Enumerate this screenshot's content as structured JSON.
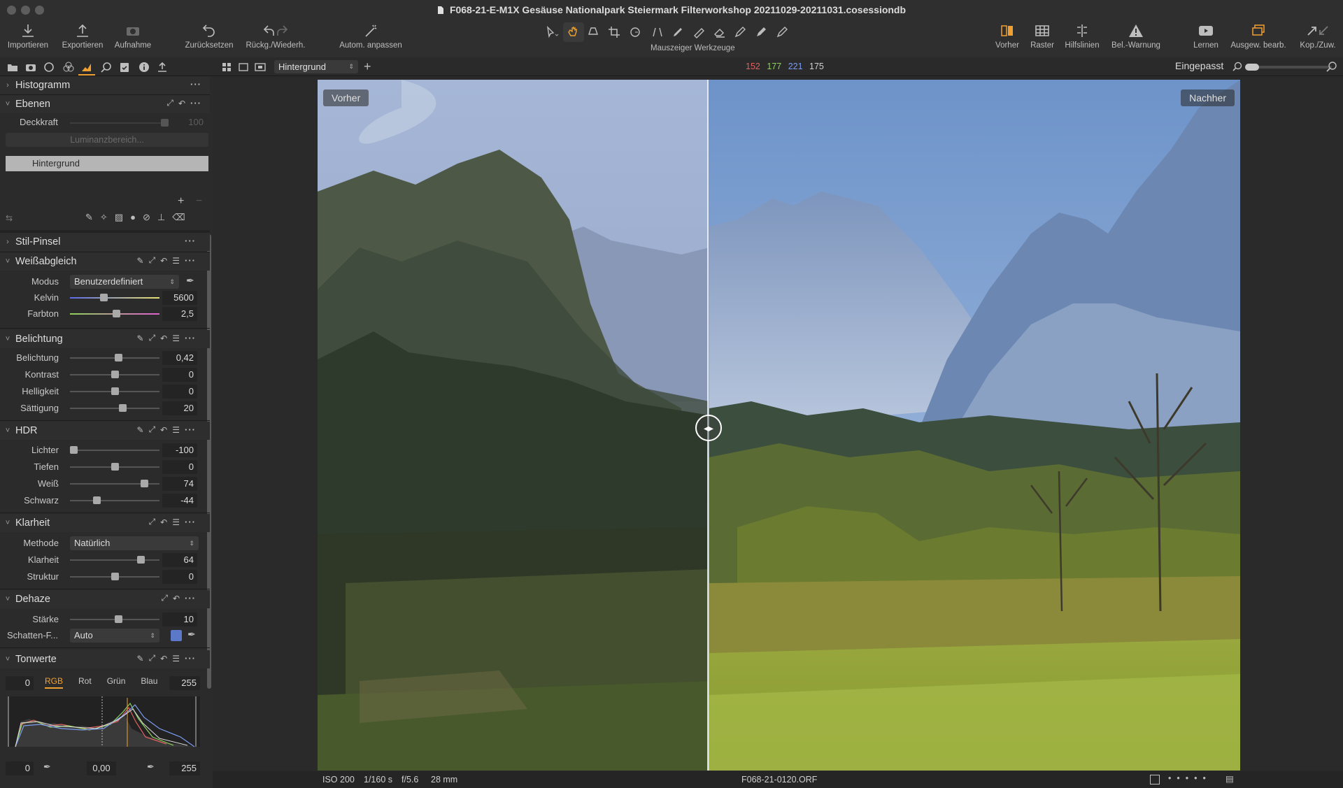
{
  "window": {
    "title": "F068-21-E-M1X Gesäuse Nationalpark Steiermark Filterworkshop 20211029-20211031.cosessiondb"
  },
  "toolbar": {
    "left": [
      "Importieren",
      "Exportieren",
      "Aufnahme",
      "Zurücksetzen",
      "Rückg./Wiederh.",
      "Autom. anpassen"
    ],
    "center_label": "Mauszeiger Werkzeuge",
    "right": [
      "Vorher",
      "Raster",
      "Hilfslinien",
      "Bel.-Warnung",
      "Lernen",
      "Ausgew. bearb.",
      "Kop./Zuw."
    ]
  },
  "viewer_bar": {
    "layer_select": "Hintergrund",
    "rgb": {
      "r": "152",
      "g": "177",
      "b": "221",
      "l": "175"
    },
    "zoom_label": "Eingepasst"
  },
  "panels": {
    "histogramm": {
      "title": "Histogramm"
    },
    "ebenen": {
      "title": "Ebenen",
      "opacity_label": "Deckkraft",
      "opacity_value": "100",
      "luminance_button": "Luminanzbereich...",
      "layer": "Hintergrund"
    },
    "stil": {
      "title": "Stil-Pinsel"
    },
    "wb": {
      "title": "Weißabgleich",
      "mode_label": "Modus",
      "mode_value": "Benutzerdefiniert",
      "kelvin_label": "Kelvin",
      "kelvin_value": "5600",
      "kelvin_pos": 0.38,
      "tint_label": "Farbton",
      "tint_value": "2,5",
      "tint_pos": 0.52
    },
    "exposure": {
      "title": "Belichtung",
      "rows": [
        {
          "label": "Belichtung",
          "value": "0,42",
          "pos": 0.54
        },
        {
          "label": "Kontrast",
          "value": "0",
          "pos": 0.5
        },
        {
          "label": "Helligkeit",
          "value": "0",
          "pos": 0.5
        },
        {
          "label": "Sättigung",
          "value": "20",
          "pos": 0.59
        }
      ]
    },
    "hdr": {
      "title": "HDR",
      "rows": [
        {
          "label": "Lichter",
          "value": "-100",
          "pos": 0.04
        },
        {
          "label": "Tiefen",
          "value": "0",
          "pos": 0.5
        },
        {
          "label": "Weiß",
          "value": "74",
          "pos": 0.83
        },
        {
          "label": "Schwarz",
          "value": "-44",
          "pos": 0.3
        }
      ]
    },
    "clarity": {
      "title": "Klarheit",
      "method_label": "Methode",
      "method_value": "Natürlich",
      "rows": [
        {
          "label": "Klarheit",
          "value": "64",
          "pos": 0.79
        },
        {
          "label": "Struktur",
          "value": "0",
          "pos": 0.5
        }
      ]
    },
    "dehaze": {
      "title": "Dehaze",
      "strength_label": "Stärke",
      "strength_value": "10",
      "strength_pos": 0.54,
      "shadow_label": "Schatten-F...",
      "shadow_value": "Auto",
      "swatch": "#5b79c8"
    },
    "levels": {
      "title": "Tonwerte",
      "in_low": "0",
      "in_high": "255",
      "out_low": "0",
      "out_mid": "0,00",
      "out_high": "255",
      "tabs": [
        "RGB",
        "Rot",
        "Grün",
        "Blau"
      ],
      "active": "RGB"
    }
  },
  "viewer": {
    "before": "Vorher",
    "after": "Nachher"
  },
  "footer": {
    "iso": "ISO 200",
    "shutter": "1/160 s",
    "aperture": "f/5.6",
    "focal": "28 mm",
    "file": "F068-21-0120.ORF"
  },
  "colors": {
    "accent": "#f0a030",
    "red": "#e06060",
    "green": "#8fd15a",
    "blue": "#7c9cf0"
  }
}
